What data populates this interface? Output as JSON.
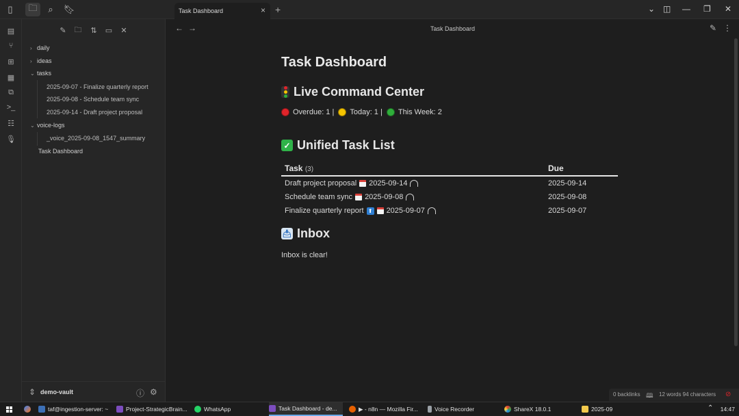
{
  "tab": {
    "title": "Task Dashboard"
  },
  "view": {
    "title": "Task Dashboard"
  },
  "sidebar": {
    "folders": [
      {
        "label": "daily",
        "expanded": false
      },
      {
        "label": "ideas",
        "expanded": false
      },
      {
        "label": "tasks",
        "expanded": true
      },
      {
        "label": "voice-logs",
        "expanded": true
      }
    ],
    "task_files": [
      "2025-09-07 - Finalize quarterly report",
      "2025-09-08 - Schedule team sync",
      "2025-09-14 - Draft project proposal"
    ],
    "voice_files": [
      "_voice_2025-09-08_1547_summary"
    ],
    "root_files": [
      "Task Dashboard"
    ],
    "vault_name": "demo-vault"
  },
  "doc": {
    "title": "Task Dashboard",
    "live_heading": "Live Command Center",
    "status": {
      "overdue": "Overdue: 1 |",
      "today": "Today: 1 |",
      "week": "This Week: 2"
    },
    "unified_heading": "Unified Task List",
    "table": {
      "col_task": "Task",
      "col_task_count": "(3)",
      "col_due": "Due",
      "rows": [
        {
          "task": "Draft project proposal",
          "date": "2025-09-14",
          "due": "2025-09-14",
          "priority": false
        },
        {
          "task": "Schedule team sync",
          "date": "2025-09-08",
          "due": "2025-09-08",
          "priority": false
        },
        {
          "task": "Finalize quarterly report",
          "date": "2025-09-07",
          "due": "2025-09-07",
          "priority": true
        }
      ]
    },
    "inbox_heading": "Inbox",
    "inbox_text": "Inbox is clear!"
  },
  "statusbar": {
    "backlinks": "0 backlinks",
    "counts": "12 words  94 characters"
  },
  "taskbar": {
    "items": [
      "taf@ingestion-server: ~",
      "Project-StrategicBrain...",
      "WhatsApp",
      "Task Dashboard - de...",
      "▶ - n8n — Mozilla Fir...",
      "Voice Recorder",
      "ShareX 18.0.1",
      "2025-09"
    ],
    "time": "14:47"
  },
  "colors": {
    "red": "#e0242a",
    "yellow": "#f5c400",
    "green": "#2fae3a",
    "check": "#2fb349",
    "accent": "#6aa9e9"
  }
}
